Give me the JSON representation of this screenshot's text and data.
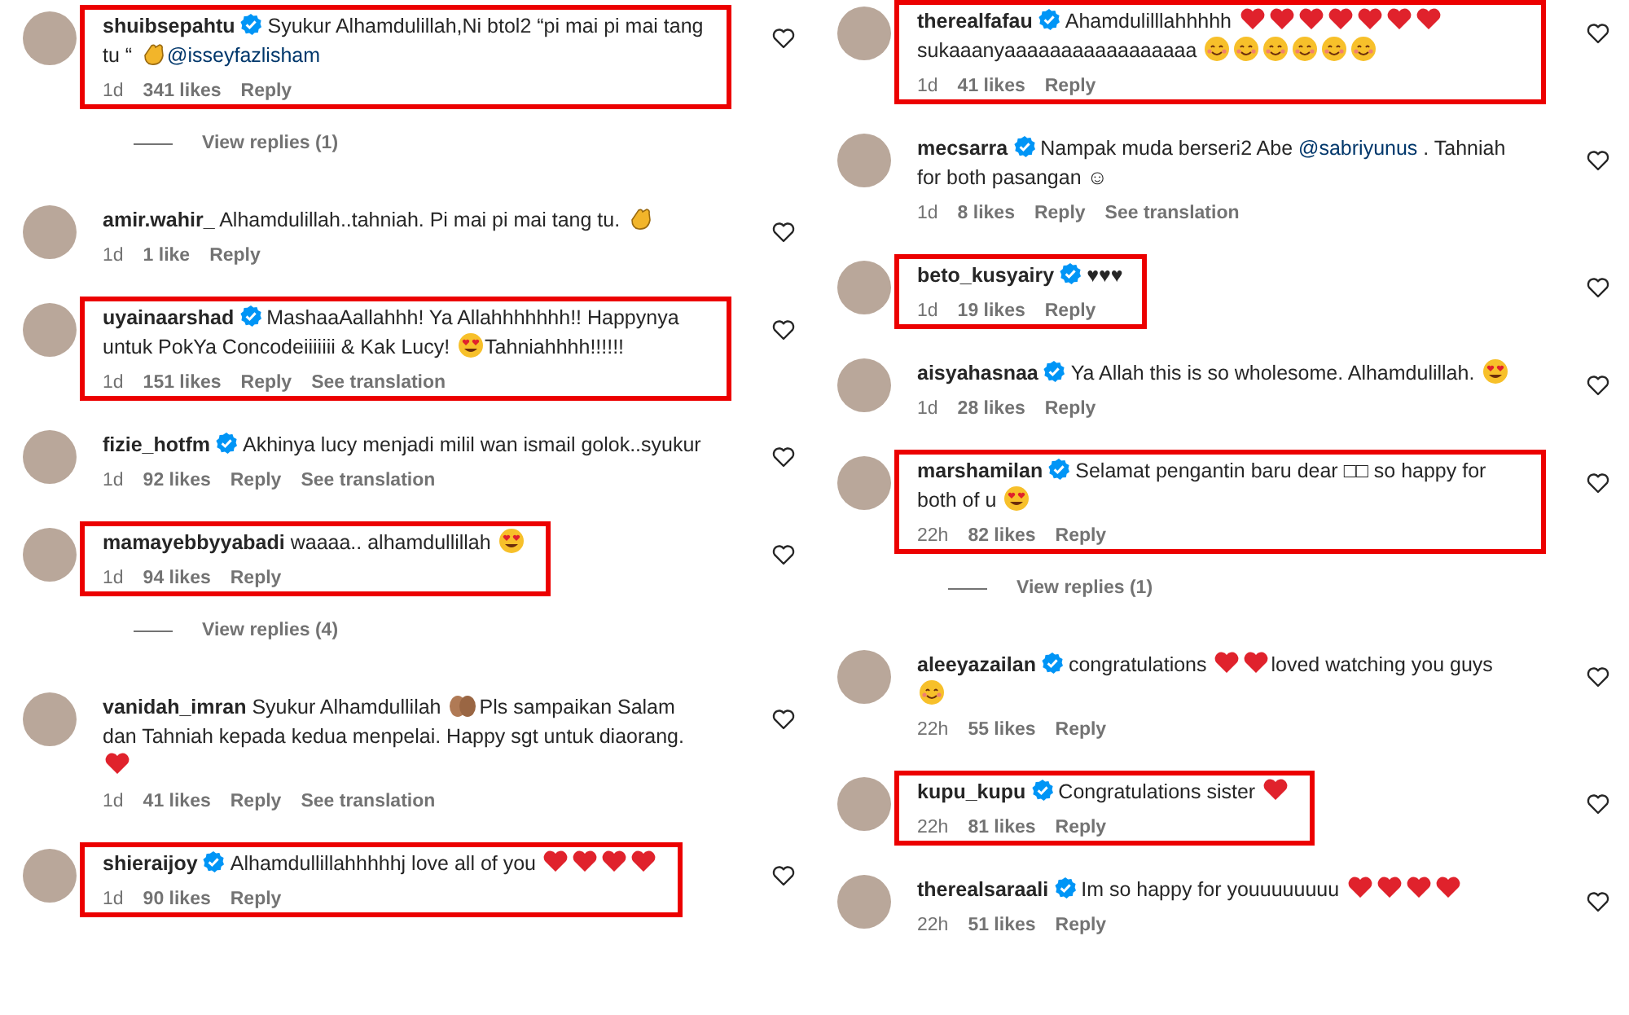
{
  "columns": [
    {
      "comments": [
        {
          "username": "shuibsepahtu",
          "verified": true,
          "highlighted": true,
          "parts": [
            {
              "kind": "text",
              "text": "Syukur Alhamdulillah,Ni btol2 “pi mai pi mai tang tu “"
            },
            {
              "kind": "clap"
            },
            {
              "kind": "mention",
              "text": "@isseyfazlisham"
            }
          ],
          "time": "1d",
          "likes": "341 likes",
          "reply": "Reply",
          "replies": "View replies (1)"
        },
        {
          "username": "amir.wahir_",
          "verified": false,
          "highlighted": false,
          "parts": [
            {
              "kind": "text",
              "text": "Alhamdulillah..tahniah. Pi mai pi mai tang tu."
            },
            {
              "kind": "clap"
            }
          ],
          "time": "1d",
          "likes": "1 like",
          "reply": "Reply"
        },
        {
          "username": "uyainaarshad",
          "verified": true,
          "highlighted": true,
          "parts": [
            {
              "kind": "text",
              "text": "MashaaAallahhh! Ya Allahhhhhhh!! Happynya untuk PokYa Concodeiiiiiii & Kak Lucy!"
            },
            {
              "kind": "hearteyes"
            },
            {
              "kind": "text",
              "text": "Tahniahhhh!!!!!!"
            }
          ],
          "time": "1d",
          "likes": "151 likes",
          "reply": "Reply",
          "translation": "See translation"
        },
        {
          "username": "fizie_hotfm",
          "verified": true,
          "highlighted": false,
          "parts": [
            {
              "kind": "text",
              "text": "Akhinya lucy menjadi milil wan ismail golok..syukur"
            }
          ],
          "time": "1d",
          "likes": "92 likes",
          "reply": "Reply",
          "translation": "See translation"
        },
        {
          "username": "mamayebbyyabadi",
          "verified": false,
          "highlighted": true,
          "parts": [
            {
              "kind": "text",
              "text": "waaaa.. alhamdullillah"
            },
            {
              "kind": "hearteyes"
            }
          ],
          "time": "1d",
          "likes": "94 likes",
          "reply": "Reply",
          "replies": "View replies (4)"
        },
        {
          "username": "vanidah_imran",
          "verified": false,
          "highlighted": false,
          "parts": [
            {
              "kind": "text",
              "text": "Syukur Alhamdullilah"
            },
            {
              "kind": "hands"
            },
            {
              "kind": "text",
              "text": "Pls sampaikan Salam dan Tahniah kepada kedua menpelai. Happy sgt untuk diaorang."
            },
            {
              "kind": "heart"
            }
          ],
          "time": "1d",
          "likes": "41 likes",
          "reply": "Reply",
          "translation": "See translation"
        },
        {
          "username": "shieraijoy",
          "verified": true,
          "highlighted": true,
          "parts": [
            {
              "kind": "text",
              "text": "Alhamdullillahhhhhj love all of you"
            },
            {
              "kind": "heart"
            },
            {
              "kind": "heart"
            },
            {
              "kind": "heart"
            },
            {
              "kind": "heart"
            }
          ],
          "time": "1d",
          "likes": "90 likes",
          "reply": "Reply"
        }
      ]
    },
    {
      "comments": [
        {
          "username": "therealfafau",
          "verified": true,
          "highlighted": true,
          "parts": [
            {
              "kind": "text",
              "text": "Ahamdulilllahhhhh"
            },
            {
              "kind": "heart"
            },
            {
              "kind": "heart"
            },
            {
              "kind": "heart"
            },
            {
              "kind": "heart"
            },
            {
              "kind": "heart"
            },
            {
              "kind": "heart"
            },
            {
              "kind": "heart"
            },
            {
              "kind": "text",
              "text": "sukaaanyaaaaaaaaaaaaaaaaa"
            },
            {
              "kind": "smiling"
            },
            {
              "kind": "smiling"
            },
            {
              "kind": "smiling"
            },
            {
              "kind": "smiling"
            },
            {
              "kind": "smiling"
            },
            {
              "kind": "smiling"
            }
          ],
          "time": "1d",
          "likes": "41 likes",
          "reply": "Reply"
        },
        {
          "username": "mecsarra",
          "verified": true,
          "highlighted": false,
          "parts": [
            {
              "kind": "text",
              "text": "Nampak muda berseri2 Abe"
            },
            {
              "kind": "mention",
              "text": "@sabriyunus"
            },
            {
              "kind": "text",
              "text": ". Tahniah for both pasangan ☺"
            }
          ],
          "time": "1d",
          "likes": "8 likes",
          "reply": "Reply",
          "translation": "See translation"
        },
        {
          "username": "beto_kusyairy",
          "verified": true,
          "highlighted": true,
          "parts": [
            {
              "kind": "text",
              "text": "♥♥♥"
            }
          ],
          "time": "1d",
          "likes": "19 likes",
          "reply": "Reply"
        },
        {
          "username": "aisyahasnaa",
          "verified": true,
          "highlighted": false,
          "parts": [
            {
              "kind": "text",
              "text": "Ya Allah this is so wholesome. Alhamdulillah."
            },
            {
              "kind": "hearteyes"
            }
          ],
          "time": "1d",
          "likes": "28 likes",
          "reply": "Reply"
        },
        {
          "username": "marshamilan",
          "verified": true,
          "highlighted": true,
          "parts": [
            {
              "kind": "text",
              "text": "Selamat pengantin baru dear □□ so happy for both of u"
            },
            {
              "kind": "hearteyes"
            }
          ],
          "time": "22h",
          "likes": "82 likes",
          "reply": "Reply",
          "replies": "View replies (1)"
        },
        {
          "username": "aleeyazailan",
          "verified": true,
          "highlighted": false,
          "parts": [
            {
              "kind": "text",
              "text": "congratulations"
            },
            {
              "kind": "heart"
            },
            {
              "kind": "heart"
            },
            {
              "kind": "text",
              "text": "loved watching you guys"
            },
            {
              "kind": "smiling"
            }
          ],
          "time": "22h",
          "likes": "55 likes",
          "reply": "Reply"
        },
        {
          "username": "kupu_kupu",
          "verified": true,
          "highlighted": true,
          "parts": [
            {
              "kind": "text",
              "text": "Congratulations sister"
            },
            {
              "kind": "heart"
            }
          ],
          "time": "22h",
          "likes": "81 likes",
          "reply": "Reply"
        },
        {
          "username": "therealsaraali",
          "verified": true,
          "highlighted": false,
          "parts": [
            {
              "kind": "text",
              "text": "Im so happy for youuuuuuuu"
            },
            {
              "kind": "heart"
            },
            {
              "kind": "heart"
            },
            {
              "kind": "heart"
            },
            {
              "kind": "heart"
            }
          ],
          "time": "22h",
          "likes": "51 likes",
          "reply": "Reply"
        }
      ]
    }
  ]
}
